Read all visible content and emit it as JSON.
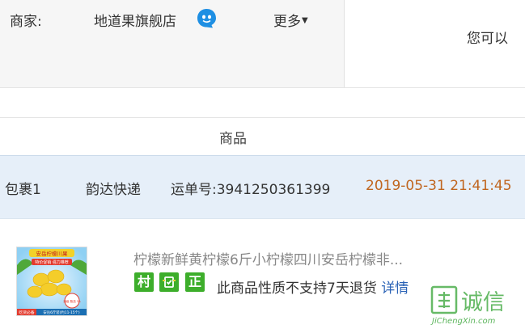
{
  "merchant": {
    "label": "商家:",
    "shop_name": "地道果旗舰店",
    "more": "更多",
    "right_text": "您可以"
  },
  "goods_header": "商品",
  "package": {
    "name": "包裹1",
    "courier": "韵达快递",
    "tracking": "运单号:3941250361399",
    "time": "2019-05-31 21:41:45"
  },
  "product": {
    "title": "柠檬新鲜黄柠檬6斤小柠檬四川安岳柠檬非...",
    "tags": [
      "村",
      "",
      "正"
    ],
    "return_note": "此商品性质不支持7天退货",
    "details_link": "详情",
    "thumb_text": {
      "banner": "安岳柠檬川果",
      "sub": "特价促销 强力推荐",
      "bottom_left": "吃货必备",
      "bottom_right": "安岳6斤装(约11-15个)",
      "badge": "满级 甄选 5A"
    }
  },
  "watermark": {
    "cn": "诚信",
    "en": "JiChengXin.com"
  },
  "colors": {
    "tag_green": "#3dae2b",
    "link_blue": "#2b63b6",
    "time_orange": "#c0651e",
    "row_bg": "#e6eff9"
  }
}
